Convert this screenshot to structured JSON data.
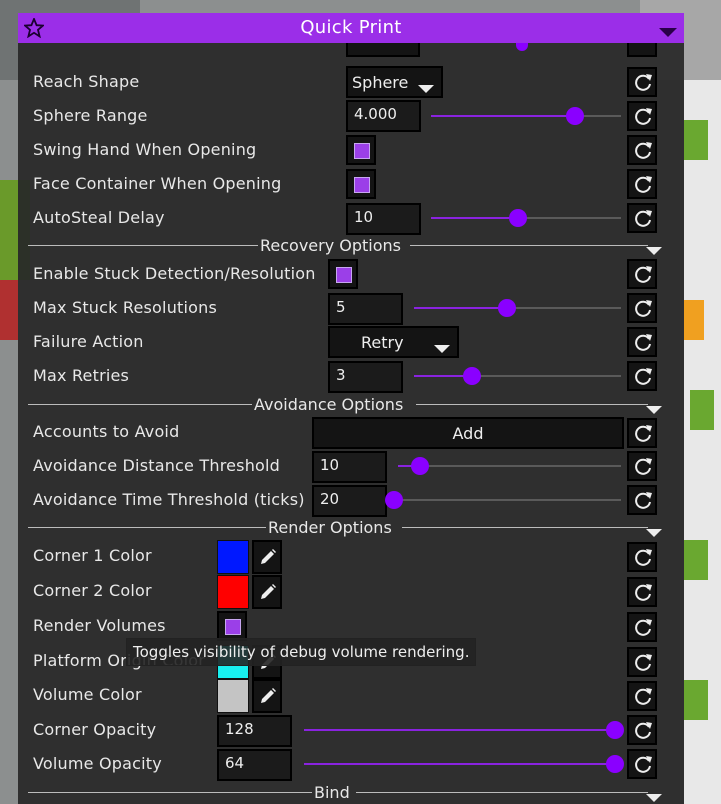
{
  "window": {
    "title": "Quick Print",
    "accent_color": "#9b2ee8"
  },
  "rows": {
    "reach_shape": {
      "label": "Reach Shape",
      "value": "Sphere"
    },
    "sphere_range": {
      "label": "Sphere Range",
      "value": "4.000",
      "level": 0.76
    },
    "swing_hand": {
      "label": "Swing Hand When Opening",
      "checked": true
    },
    "face_container": {
      "label": "Face Container When Opening",
      "checked": true
    },
    "autosteal_delay": {
      "label": "AutoSteal Delay",
      "value": "10",
      "level": 0.46
    },
    "enable_stuck": {
      "label": "Enable Stuck Detection/Resolution",
      "checked": true
    },
    "max_stuck": {
      "label": "Max Stuck Resolutions",
      "value": "5",
      "level": 0.45
    },
    "failure_action": {
      "label": "Failure Action",
      "value": "Retry"
    },
    "max_retries": {
      "label": "Max Retries",
      "value": "3",
      "level": 0.28
    },
    "accounts_to_avoid": {
      "label": "Accounts to Avoid",
      "button": "Add"
    },
    "avoid_distance": {
      "label": "Avoidance Distance Threshold",
      "value": "10",
      "level": 0.1
    },
    "avoid_time": {
      "label": "Avoidance Time Threshold (ticks)",
      "value": "20",
      "level": 0.02
    },
    "corner1": {
      "label": "Corner 1 Color",
      "color": "#0018ff"
    },
    "corner2": {
      "label": "Corner 2 Color",
      "color": "#ff0000"
    },
    "render_volumes": {
      "label": "Render Volumes",
      "checked": true
    },
    "platform_origin": {
      "label": "Platform Origin Color",
      "color": "#18f0f0"
    },
    "volume_color": {
      "label": "Volume Color",
      "color": "#c4c4c4"
    },
    "corner_opacity": {
      "label": "Corner Opacity",
      "value": "128",
      "level": 1.0
    },
    "volume_opacity": {
      "label": "Volume Opacity",
      "value": "64",
      "level": 1.0
    }
  },
  "sections": {
    "recovery": "Recovery Options",
    "avoidance": "Avoidance Options",
    "render": "Render Options",
    "bind": "Bind"
  },
  "tooltip": "Toggles visibility of debug volume rendering.",
  "icons": {
    "reset": "reset-icon",
    "star": "star-icon",
    "collapse": "triangle-down-icon",
    "pencil": "pencil-icon"
  }
}
